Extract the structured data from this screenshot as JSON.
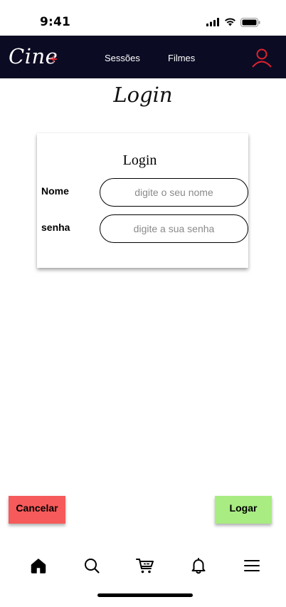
{
  "status_bar": {
    "time": "9:41",
    "icons": [
      "signal-icon",
      "wifi-icon",
      "battery-icon"
    ]
  },
  "navbar": {
    "logo_text": "Cine",
    "logo_plus": "+",
    "links": [
      {
        "label": "Sessões"
      },
      {
        "label": "Filmes"
      }
    ],
    "user_icon": "user-icon",
    "background": "#0b0b24",
    "accent": "#e0222e"
  },
  "page": {
    "title": "Login"
  },
  "login_card": {
    "title": "Login",
    "fields": [
      {
        "label": "Nome",
        "value": "",
        "placeholder": "digite o seu nome"
      },
      {
        "label": "senha",
        "value": "",
        "placeholder": "digite a sua senha"
      }
    ]
  },
  "actions": {
    "cancel_label": "Cancelar",
    "cancel_color": "#f65a5a",
    "login_label": "Logar",
    "login_color": "#a8ec82"
  },
  "bottom_nav": {
    "items": [
      {
        "icon": "home-icon"
      },
      {
        "icon": "search-icon"
      },
      {
        "icon": "cart-icon"
      },
      {
        "icon": "bell-icon"
      },
      {
        "icon": "menu-icon"
      }
    ]
  }
}
